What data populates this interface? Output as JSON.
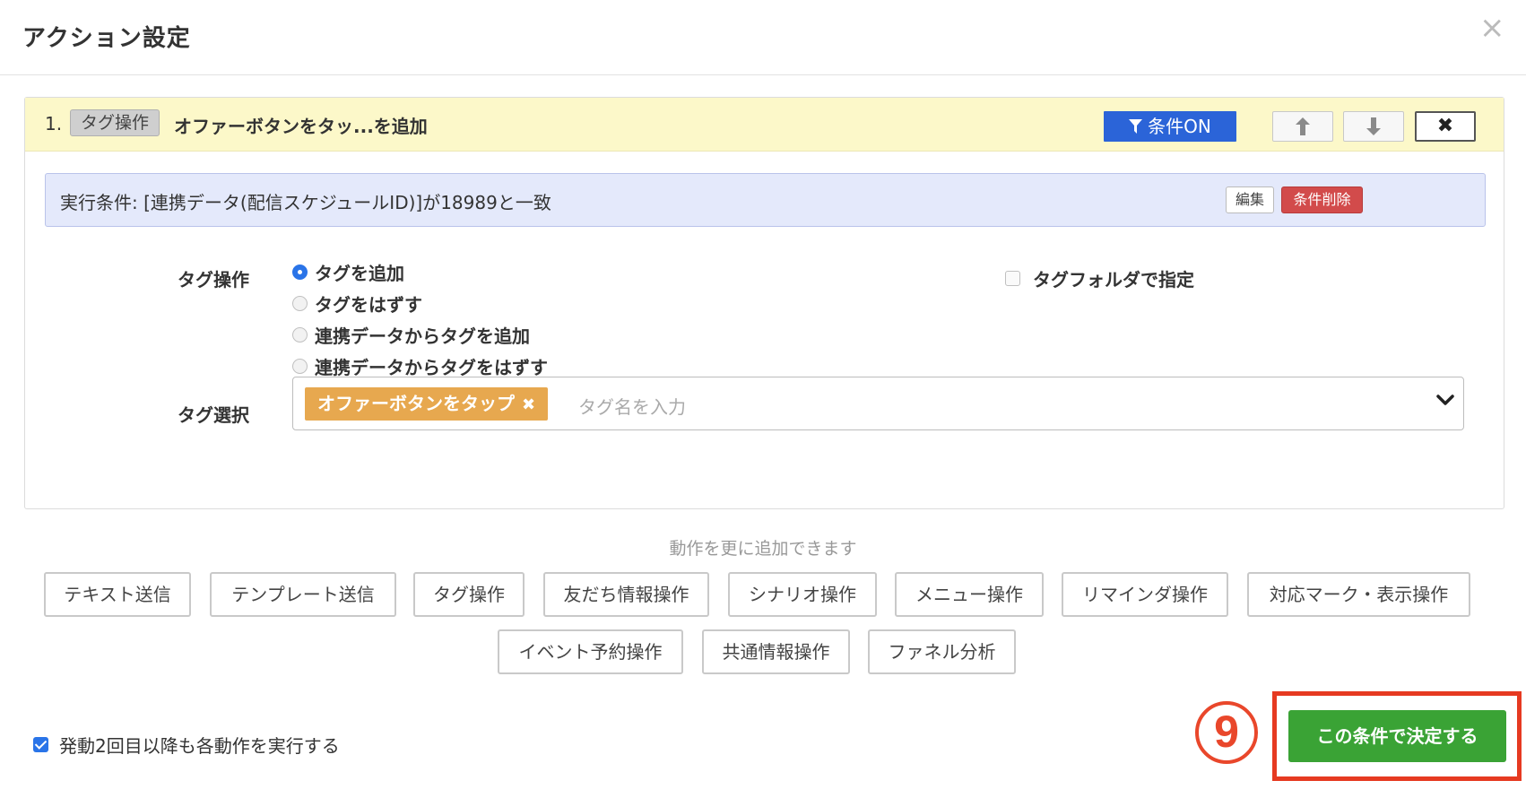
{
  "modal": {
    "title": "アクション設定",
    "close_label": "×"
  },
  "action": {
    "number": "1.",
    "type_badge": "タグ操作",
    "title": "オファーボタンをタッ...を追加",
    "condition_toggle_label": "条件ON",
    "move_up_label": "🡅",
    "move_down_label": "🡇",
    "delete_label": "✖",
    "condition_text": "実行条件: [連携データ(配信スケジュールID)]が18989と一致",
    "edit_label": "編集",
    "condition_delete_label": "条件削除",
    "tag_operation_label": "タグ操作",
    "tag_operation_options": [
      {
        "label": "タグを追加",
        "checked": true
      },
      {
        "label": "タグをはずす",
        "checked": false
      },
      {
        "label": "連携データからタグを追加",
        "checked": false
      },
      {
        "label": "連携データからタグをはずす",
        "checked": false
      }
    ],
    "folder_checkbox_label": "タグフォルダで指定",
    "tag_select_label": "タグ選択",
    "selected_tag": "オファーボタンをタップ",
    "selected_tag_remove": "✖",
    "tag_input_placeholder": "タグ名を入力"
  },
  "add_more_hint": "動作を更に追加できます",
  "action_buttons_row1": [
    "テキスト送信",
    "テンプレート送信",
    "タグ操作",
    "友だち情報操作",
    "シナリオ操作",
    "メニュー操作",
    "リマインダ操作",
    "対応マーク・表示操作"
  ],
  "action_buttons_row2": [
    "イベント予約操作",
    "共通情報操作",
    "ファネル分析"
  ],
  "repeat_checkbox_label": "発動2回目以降も各動作を実行する",
  "step_marker": "9",
  "confirm_label": "この条件で決定する",
  "colors": {
    "header_bg": "#fcf8c9",
    "condition_bg": "#e4e9fb",
    "primary_blue": "#2b64d8",
    "danger_red": "#d24b4b",
    "tag_chip": "#e7a84f",
    "confirm_green": "#3aa335",
    "highlight_red": "#e63a21"
  }
}
